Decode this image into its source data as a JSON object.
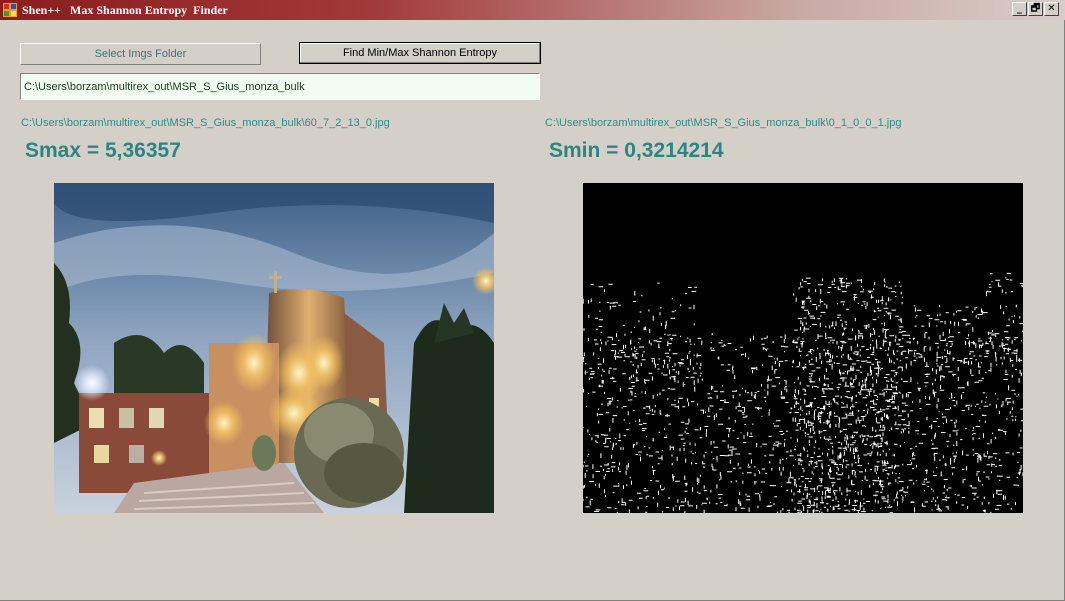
{
  "window": {
    "title": "Shen++   Max Shannon Entropy  Finder",
    "controls": {
      "minimize": "_",
      "maximize": "🗗",
      "close": "✕"
    }
  },
  "toolbar": {
    "select_folder_label": "Select Imgs Folder",
    "find_entropy_label": "Find Min/Max Shannon Entropy"
  },
  "folder_path": "C:\\Users\\borzam\\multirex_out\\MSR_S_Gius_monza_bulk",
  "max_result": {
    "file_path": "C:\\Users\\borzam\\multirex_out\\MSR_S_Gius_monza_bulk\\60_7_2_13_0.jpg",
    "label": "Smax = 5,36357"
  },
  "min_result": {
    "file_path": "C:\\Users\\borzam\\multirex_out\\MSR_S_Gius_monza_bulk\\0_1_0_0_1.jpg",
    "label": "Smin = 0,3214214"
  },
  "colors": {
    "accent_teal": "#2a8682",
    "titlebar_red": "#8a1c1c",
    "window_bg": "#d4d0c8",
    "input_bg": "#f1fdf0"
  }
}
